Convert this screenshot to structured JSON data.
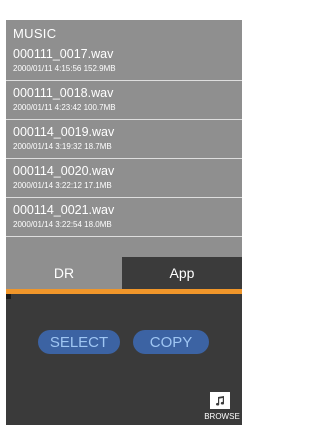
{
  "folder": {
    "title": "MUSIC"
  },
  "files": [
    {
      "name": "000111_0017.wav",
      "meta": "2000/01/11 4:15:56 152.9MB"
    },
    {
      "name": "000111_0018.wav",
      "meta": "2000/01/11 4:23:42 100.7MB"
    },
    {
      "name": "000114_0019.wav",
      "meta": "2000/01/14 3:19:32 18.7MB"
    },
    {
      "name": "000114_0020.wav",
      "meta": "2000/01/14 3:22:12 17.1MB"
    },
    {
      "name": "000114_0021.wav",
      "meta": "2000/01/14 3:22:54 18.0MB"
    }
  ],
  "tabs": {
    "dr_label": "DR",
    "app_label": "App",
    "active": "DR"
  },
  "actions": {
    "select_label": "SELECT",
    "copy_label": "COPY"
  },
  "browse": {
    "label": "BROWSE",
    "icon": "music-note-icon"
  },
  "colors": {
    "accent": "#f0962a",
    "button_bg": "#3c63a3",
    "button_text": "#9fc6f3",
    "list_bg": "#8f8f8f",
    "screen_bg": "#3a3a3a"
  }
}
